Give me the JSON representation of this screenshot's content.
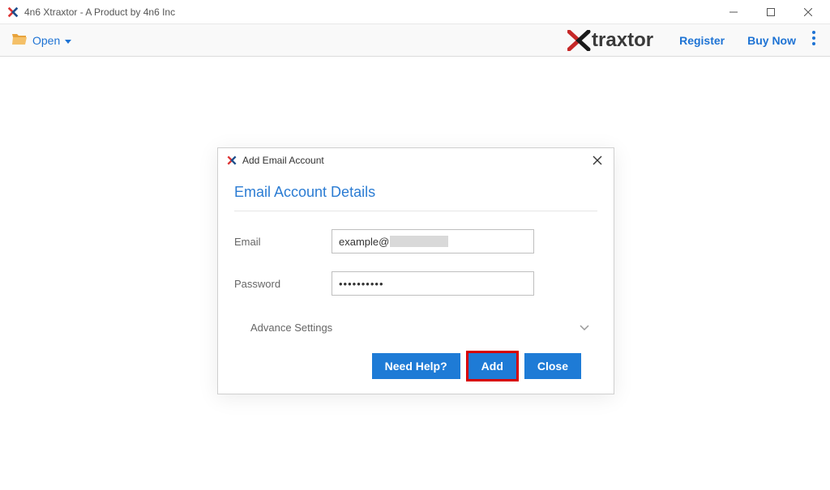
{
  "window": {
    "title": "4n6 Xtraxtor - A Product by 4n6 Inc"
  },
  "toolbar": {
    "open_label": "Open",
    "brand_text": "traxtor",
    "register_label": "Register",
    "buy_now_label": "Buy Now"
  },
  "modal": {
    "title": "Add Email Account",
    "section_title": "Email Account Details",
    "email_label": "Email",
    "email_value": "example@",
    "password_label": "Password",
    "password_value": "••••••••••",
    "advance_label": "Advance Settings",
    "buttons": {
      "need_help": "Need Help?",
      "add": "Add",
      "close": "Close"
    }
  }
}
